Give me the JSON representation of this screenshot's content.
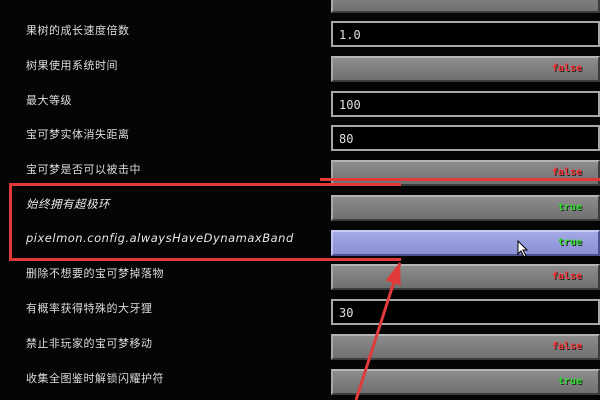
{
  "settings": [
    {
      "label": "",
      "kind": "toggle",
      "value": "",
      "italic": false
    },
    {
      "label": "果树的成长速度倍数",
      "kind": "text",
      "value": "1.0",
      "italic": false
    },
    {
      "label": "树果使用系统时间",
      "kind": "toggle",
      "value": "false",
      "italic": false
    },
    {
      "label": "最大等级",
      "kind": "text",
      "value": "100",
      "italic": false
    },
    {
      "label": "宝可梦实体消失距离",
      "kind": "text",
      "value": "80",
      "italic": false
    },
    {
      "label": "宝可梦是否可以被击中",
      "kind": "toggle",
      "value": "false",
      "italic": false
    },
    {
      "label": "始终拥有超极环",
      "kind": "toggle",
      "value": "true",
      "italic": true
    },
    {
      "label": "pixelmon.config.alwaysHaveDynamaxBand",
      "kind": "toggle",
      "value": "true",
      "italic": true,
      "hover": true
    },
    {
      "label": "删除不想要的宝可梦掉落物",
      "kind": "toggle",
      "value": "false",
      "italic": false
    },
    {
      "label": "有概率获得特殊的大牙狸",
      "kind": "text",
      "value": "30",
      "italic": false
    },
    {
      "label": "禁止非玩家的宝可梦移动",
      "kind": "toggle",
      "value": "false",
      "italic": false
    },
    {
      "label": "收集全图鉴时解锁闪耀护符",
      "kind": "toggle",
      "value": "true",
      "italic": false
    }
  ],
  "colors": {
    "annotation": "#e03a3a",
    "true": "#36e036",
    "false": "#ff3b3b",
    "hover": "#9aa0e0"
  }
}
